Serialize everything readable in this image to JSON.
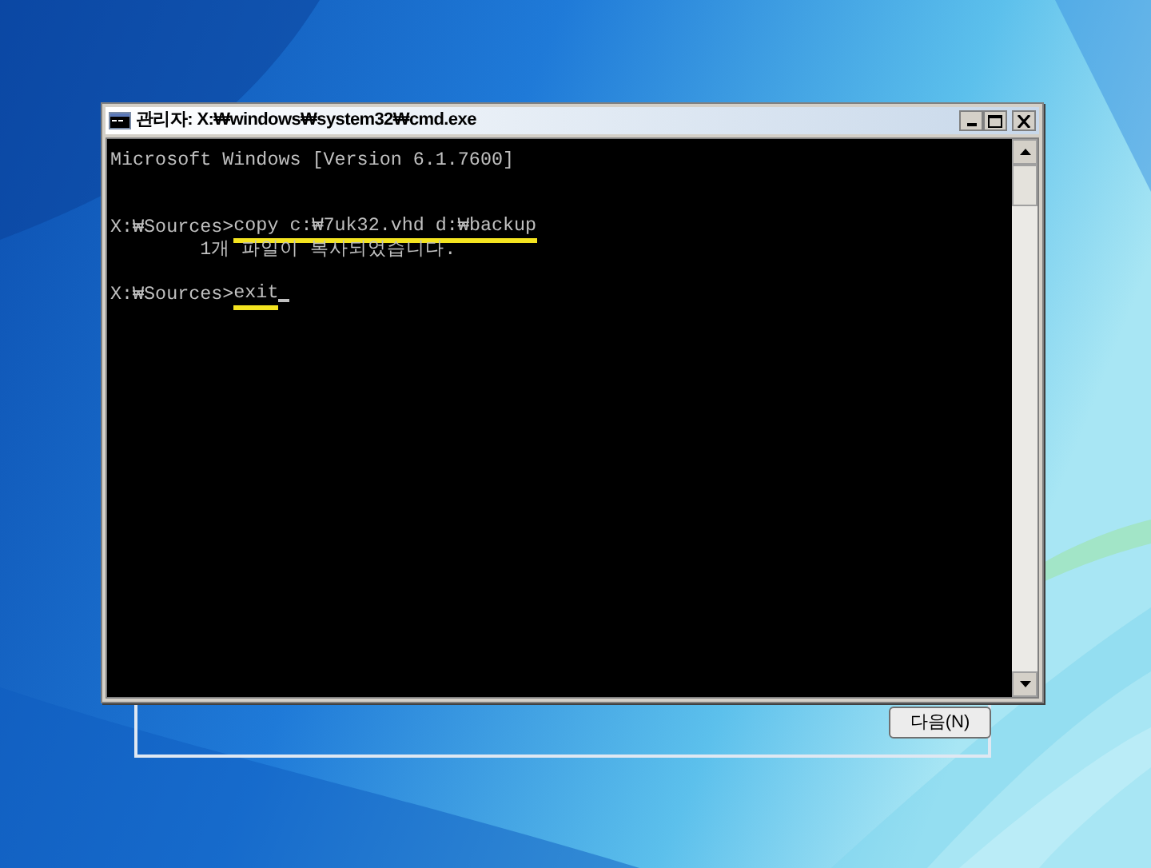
{
  "setup_window": {
    "next_button": "다음(N)"
  },
  "console_window": {
    "title": "관리자: X:₩windows₩system32₩cmd.exe",
    "lines": [
      {
        "kind": "output",
        "text": "Microsoft Windows [Version 6.1.7600]"
      },
      {
        "kind": "blank"
      },
      {
        "kind": "blank"
      },
      {
        "kind": "command",
        "prompt": "X:₩Sources>",
        "command": "copy c:₩7uk32.vhd d:₩backup",
        "highlighted": true
      },
      {
        "kind": "output",
        "text": "        1개 파일이 복사되었습니다."
      },
      {
        "kind": "blank"
      },
      {
        "kind": "command",
        "prompt": "X:₩Sources>",
        "command": "exit",
        "highlighted": true
      }
    ]
  }
}
